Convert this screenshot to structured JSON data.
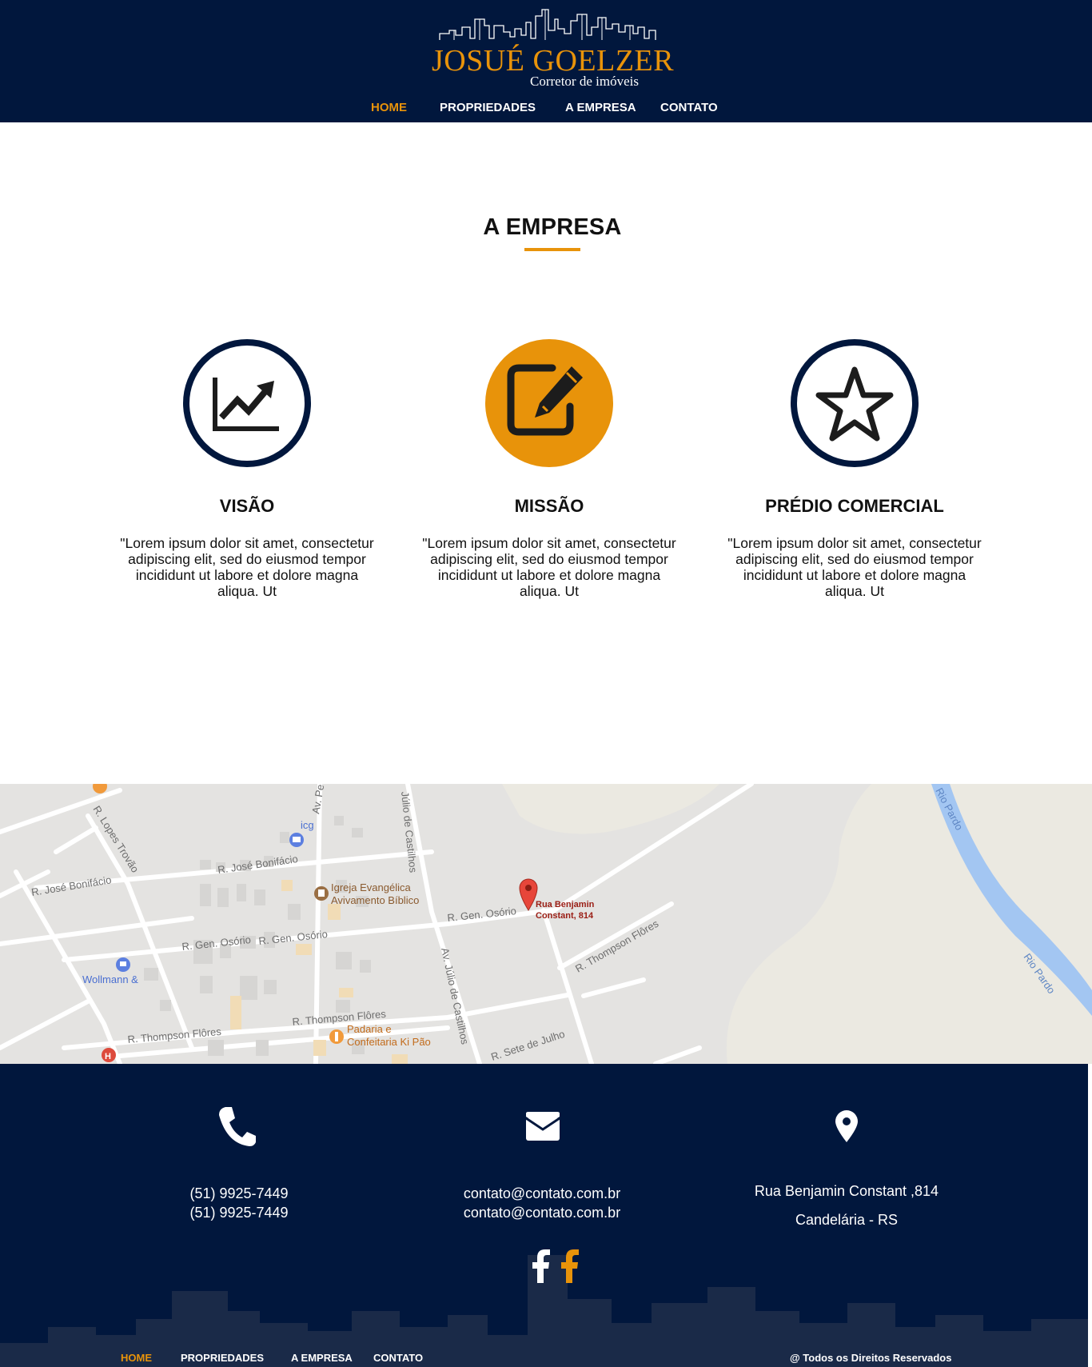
{
  "brand": {
    "name": "JOSUÉ GOELZER",
    "tagline": "Corretor de imóveis",
    "accent_color": "#e8930a",
    "navy_color": "#01173d"
  },
  "nav": {
    "items": [
      {
        "label": "HOME",
        "active": true
      },
      {
        "label": "PROPRIEDADES",
        "active": false
      },
      {
        "label": "A EMPRESA",
        "active": false
      },
      {
        "label": "CONTATO",
        "active": false
      }
    ]
  },
  "company": {
    "title": "A EMPRESA",
    "features": [
      {
        "icon": "chart-growth-icon",
        "title": "VISÃO",
        "text": "\"Lorem ipsum dolor sit amet, consectetur adipiscing elit, sed do eiusmod tempor incididunt ut labore et dolore magna aliqua. Ut"
      },
      {
        "icon": "edit-pencil-icon",
        "title": "MISSÃO",
        "text": "\"Lorem ipsum dolor sit amet, consectetur adipiscing elit, sed do eiusmod tempor incididunt ut labore et dolore magna aliqua. Ut"
      },
      {
        "icon": "star-icon",
        "title": "PRÉDIO COMERCIAL",
        "text": "\"Lorem ipsum dolor sit amet, consectetur adipiscing elit, sed do eiusmod tempor incididunt ut labore et dolore magna aliqua. Ut"
      }
    ]
  },
  "map": {
    "marker_label": [
      "Rua Benjamin",
      "Constant, 814"
    ],
    "streets": [
      "R. Lopes Trovão",
      "R. José Bonifácio",
      "R. José Bonifácio",
      "Av. Pe",
      "Júlio de Castilhos",
      "R. Gen. Osório",
      "R. Gen. Osório",
      "R. Gen. Osório",
      "Av. Júlio de Castilhos",
      "R. Thompson Flôres",
      "R. Thompson Flôres",
      "R. Thompson Flôres",
      "R. Sete de Julho",
      "Rio Pardo",
      "Rio Pardo"
    ],
    "places": [
      "icg",
      "Igreja Evangélica",
      "Avivamento Bíblico",
      "Wollmann &",
      "Padaria e",
      "Confeitaria Ki Pão"
    ]
  },
  "contact": {
    "phones": [
      "(51) 9925-7449",
      "(51) 9925-7449"
    ],
    "emails": [
      "contato@contato.com.br",
      "contato@contato.com.br"
    ],
    "address_line1": "Rua Benjamin Constant ,814",
    "address_line2": "Candelária - RS"
  },
  "footer": {
    "nav": [
      "HOME",
      "PROPRIEDADES",
      "A EMPRESA",
      "CONTATO"
    ],
    "copyright": "@ Todos os Direitos Reservados"
  }
}
